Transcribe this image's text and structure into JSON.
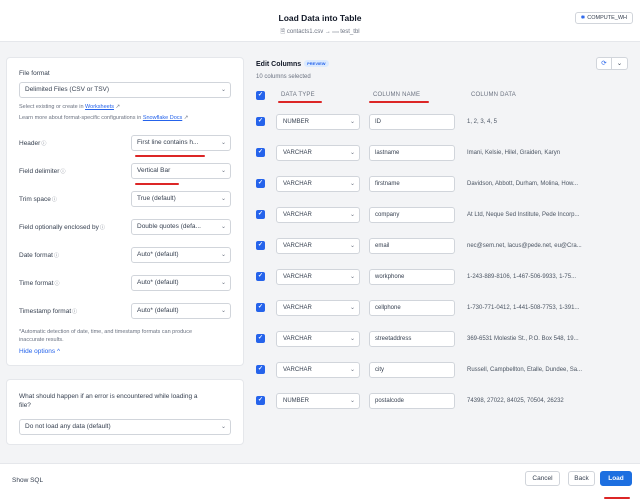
{
  "header": {
    "title": "Load Data into Table",
    "source_file": "contacts1.csv",
    "target_table": "test_tbl",
    "warehouse": "COMPUTE_WH"
  },
  "file_format": {
    "section_label": "File format",
    "format_value": "Delimited Files (CSV or TSV)",
    "help_line1": "Select existing or create in",
    "help_link1": "Worksheets",
    "help_line2": "Learn more about format-specific configurations in",
    "help_link2": "Snowflake Docs",
    "fields": [
      {
        "label": "Header",
        "value": "First line contains h..."
      },
      {
        "label": "Field delimiter",
        "value": "Vertical Bar"
      },
      {
        "label": "Trim space",
        "value": "True (default)"
      },
      {
        "label": "Field optionally enclosed by",
        "value": "Double quotes (defa..."
      },
      {
        "label": "Date format",
        "value": "Auto* (default)"
      },
      {
        "label": "Time format",
        "value": "Auto* (default)"
      },
      {
        "label": "Timestamp format",
        "value": "Auto* (default)"
      }
    ],
    "note_line1": "*Automatic detection of date, time, and timestamp formats can produce",
    "note_line2": "inaccurate results.",
    "hide_options": "Hide options"
  },
  "error_handling": {
    "question_line1": "What should happen if an error is encountered while loading a",
    "question_line2": "file?",
    "value": "Do not load any data (default)"
  },
  "edit_columns": {
    "title": "Edit Columns",
    "badge": "PREVIEW",
    "count_text": "10 columns selected",
    "headers": {
      "type": "DATA TYPE",
      "name": "COLUMN NAME",
      "data": "COLUMN DATA"
    },
    "rows": [
      {
        "type": "NUMBER",
        "name": "ID",
        "data": "1, 2, 3, 4, 5"
      },
      {
        "type": "VARCHAR",
        "name": "lastname",
        "data": "Imani, Kelsie, Hilel, Graiden, Karyn"
      },
      {
        "type": "VARCHAR",
        "name": "firstname",
        "data": "Davidson, Abbott, Durham, Molina, How..."
      },
      {
        "type": "VARCHAR",
        "name": "company",
        "data": "At Ltd, Neque Sed Institute, Pede Incorp..."
      },
      {
        "type": "VARCHAR",
        "name": "email",
        "data": "nec@sem.net, lacus@pede.net, eu@Cra..."
      },
      {
        "type": "VARCHAR",
        "name": "workphone",
        "data": "1-243-889-8106, 1-467-506-9933, 1-75..."
      },
      {
        "type": "VARCHAR",
        "name": "cellphone",
        "data": "1-730-771-0412, 1-441-508-7753, 1-391..."
      },
      {
        "type": "VARCHAR",
        "name": "streetaddress",
        "data": "369-6531 Molestie St., P.O. Box 548, 19..."
      },
      {
        "type": "VARCHAR",
        "name": "city",
        "data": "Russell, Campbellton, Etalle, Dundee, Sa..."
      },
      {
        "type": "NUMBER",
        "name": "postalcode",
        "data": "74398, 27022, 84025, 70504, 26232"
      }
    ]
  },
  "footer": {
    "show_sql": "Show SQL",
    "cancel": "Cancel",
    "back": "Back",
    "load": "Load"
  },
  "colors": {
    "accent": "#1d6fe0",
    "annotation": "#dc2626"
  }
}
